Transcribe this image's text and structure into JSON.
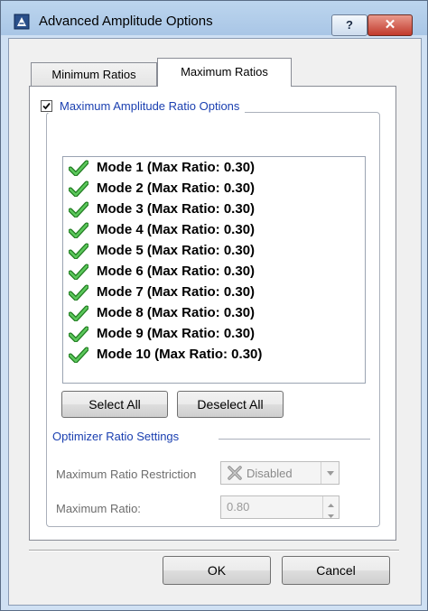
{
  "window": {
    "title": "Advanced Amplitude Options",
    "help_label": "?",
    "close_label": "✕"
  },
  "tabs": [
    {
      "label": "Minimum Ratios",
      "active": false
    },
    {
      "label": "Maximum Ratios",
      "active": true
    }
  ],
  "group": {
    "checked": true,
    "label": "Maximum Amplitude Ratio Options"
  },
  "modes": [
    {
      "label": "Mode 1 (Max Ratio: 0.30)",
      "checked": true
    },
    {
      "label": "Mode 2 (Max Ratio: 0.30)",
      "checked": true
    },
    {
      "label": "Mode 3 (Max Ratio: 0.30)",
      "checked": true
    },
    {
      "label": "Mode 4 (Max Ratio: 0.30)",
      "checked": true
    },
    {
      "label": "Mode 5 (Max Ratio: 0.30)",
      "checked": true
    },
    {
      "label": "Mode 6 (Max Ratio: 0.30)",
      "checked": true
    },
    {
      "label": "Mode 7 (Max Ratio: 0.30)",
      "checked": true
    },
    {
      "label": "Mode 8 (Max Ratio: 0.30)",
      "checked": true
    },
    {
      "label": "Mode 9 (Max Ratio: 0.30)",
      "checked": true
    },
    {
      "label": "Mode 10 (Max Ratio: 0.30)",
      "checked": true
    }
  ],
  "buttons": {
    "select_all": "Select All",
    "deselect_all": "Deselect All",
    "ok": "OK",
    "cancel": "Cancel"
  },
  "optimizer": {
    "heading": "Optimizer Ratio Settings",
    "restriction_label": "Maximum Ratio Restriction",
    "restriction_value": "Disabled",
    "ratio_label": "Maximum Ratio:",
    "ratio_value": "0.80"
  },
  "colors": {
    "accent_text": "#1a3fb0",
    "check_green": "#3aa23a",
    "close_red": "#c1392b"
  }
}
